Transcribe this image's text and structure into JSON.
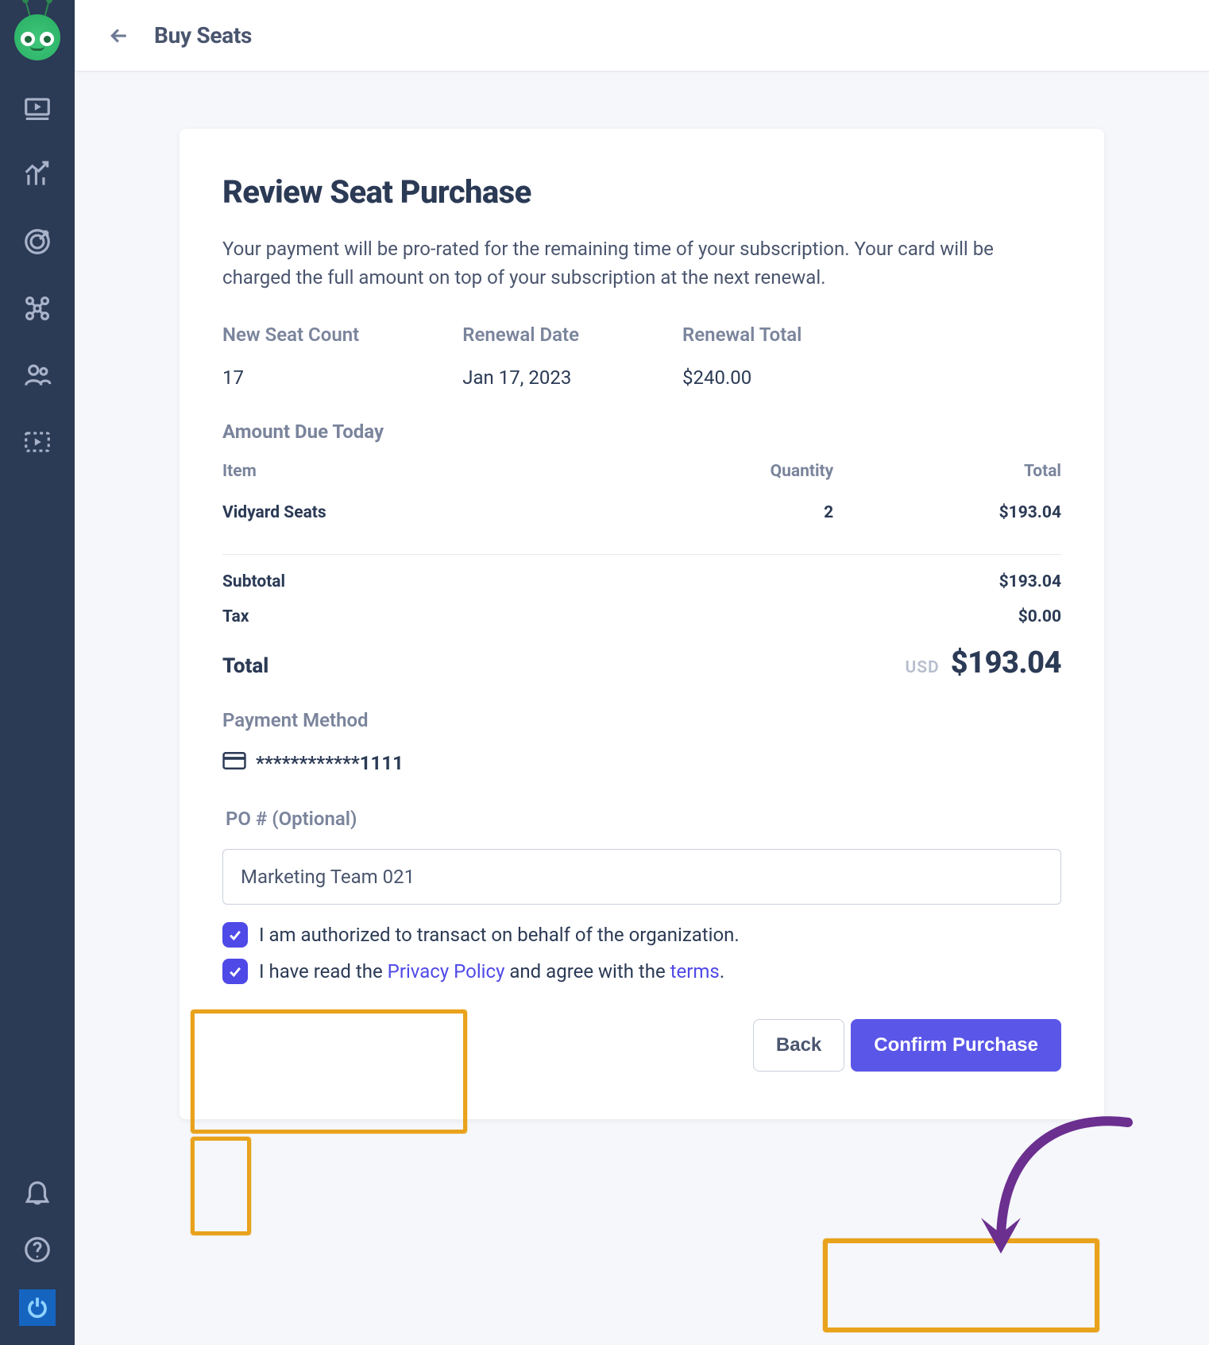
{
  "header": {
    "title": "Buy Seats"
  },
  "card": {
    "heading": "Review Seat Purchase",
    "description": "Your payment will be pro-rated for the remaining time of your subscription. Your card will be charged the full amount on top of your subscription at the next renewal."
  },
  "summary_cols": {
    "seat_count_label": "New Seat Count",
    "seat_count_value": "17",
    "renewal_date_label": "Renewal Date",
    "renewal_date_value": "Jan 17, 2023",
    "renewal_total_label": "Renewal Total",
    "renewal_total_value": "$240.00"
  },
  "due_today": {
    "section_label": "Amount Due Today",
    "columns": {
      "item": "Item",
      "qty": "Quantity",
      "total": "Total"
    },
    "rows": [
      {
        "item": "Vidyard Seats",
        "qty": "2",
        "total": "$193.04"
      }
    ],
    "subtotal_label": "Subtotal",
    "subtotal_value": "$193.04",
    "tax_label": "Tax",
    "tax_value": "$0.00",
    "total_label": "Total",
    "currency": "USD",
    "total_value": "$193.04"
  },
  "payment_method": {
    "section_label": "Payment Method",
    "card_masked": "************1111"
  },
  "po": {
    "label": "PO # (Optional)",
    "value": "Marketing Team 021"
  },
  "consents": {
    "authorized": "I am authorized to transact on behalf of the organization.",
    "policy_pre": "I have read the ",
    "policy_link": "Privacy Policy",
    "policy_mid": " and agree with the ",
    "terms_link": "terms",
    "policy_post": "."
  },
  "actions": {
    "back": "Back",
    "confirm": "Confirm Purchase"
  }
}
